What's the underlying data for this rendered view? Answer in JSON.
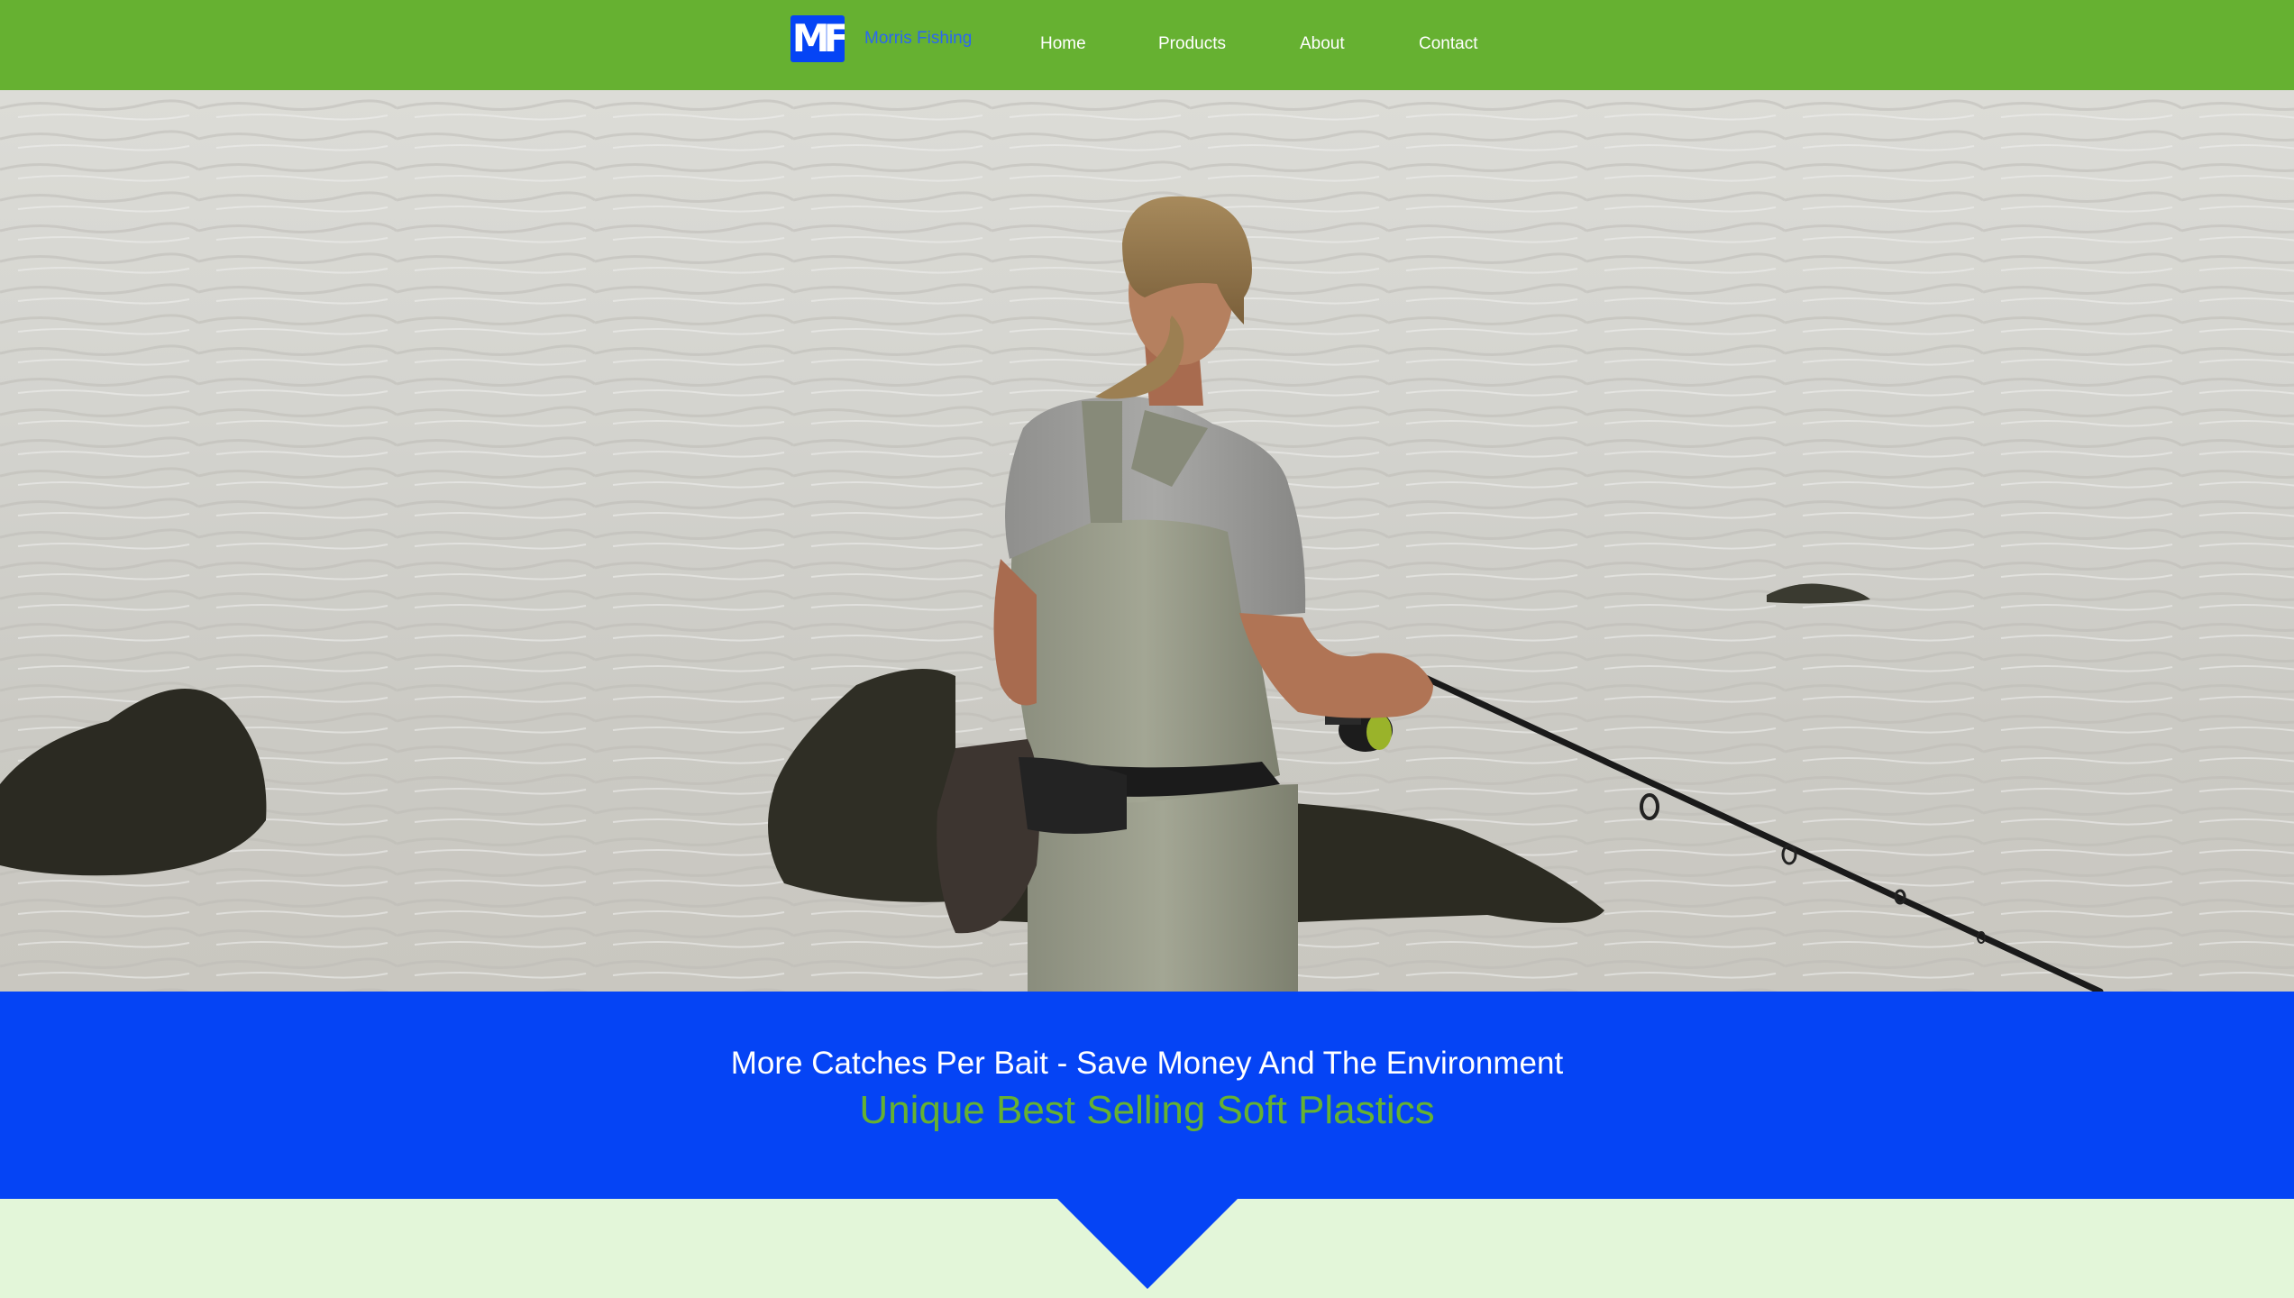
{
  "brand": {
    "logo_text": "MF",
    "name": "Morris Fishing"
  },
  "nav": {
    "items": [
      {
        "label": "Home"
      },
      {
        "label": "Products"
      },
      {
        "label": "About"
      },
      {
        "label": "Contact"
      }
    ]
  },
  "hero": {
    "alt": "Angler in waders fishing from rocks in grey sea water"
  },
  "banner": {
    "headline": "More Catches Per Bait - Save Money And The Environment",
    "subline": "Unique Best Selling Soft Plastics"
  },
  "colors": {
    "nav_green": "#66b131",
    "brand_blue": "#0544f5",
    "page_background": "#e3f6d9"
  },
  "icons": {
    "scroll_pointer": "down-triangle-icon"
  }
}
